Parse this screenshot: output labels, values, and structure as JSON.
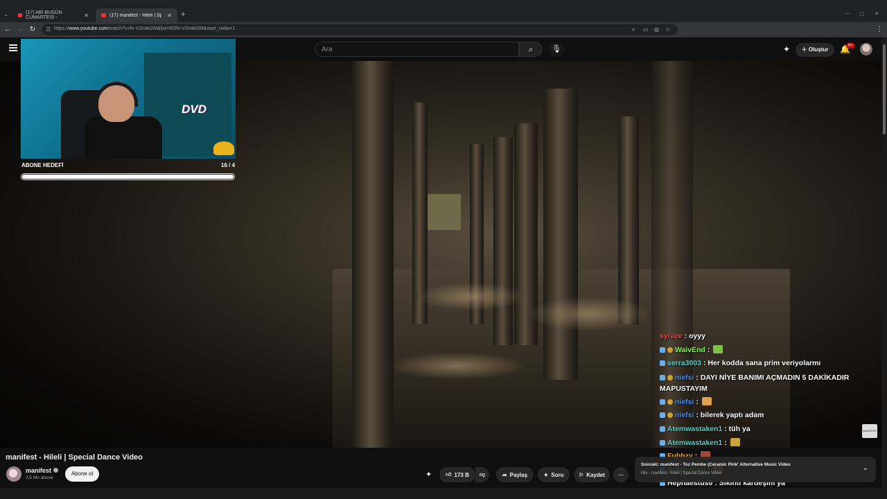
{
  "browser": {
    "tabs": [
      {
        "label": "(17) ABİ BUGÜN CUMARTESİ -",
        "active": false
      },
      {
        "label": "(17) manifest - Hileli | Special D",
        "active": true
      }
    ],
    "url_prefix": "https://",
    "url_host": "www.youtube.com",
    "url_path": "/watch?v=fn-V2mlei2M&list=RDfn-V2mlei2M&start_radio=1"
  },
  "header": {
    "search_placeholder": "Ara",
    "create_label": "Oluştur",
    "notifications_badge": "9+"
  },
  "overlay": {
    "goal_label": "ABONE HEDEFİ",
    "goal_count": "16 / 4",
    "goal_progress": 1.0,
    "dvd_text": "DVD"
  },
  "chat": [
    {
      "user": "syraze",
      "user_color": "#ff3b3b",
      "text": ": oyyy",
      "badges": 0
    },
    {
      "user": "WaivEnd",
      "user_color": "#7cfc4a",
      "text": ":",
      "badges": 2,
      "emote": true
    },
    {
      "user": "serra3003",
      "user_color": "#4fd2c8",
      "text": ": Her kodda sana prim veriyolarmı",
      "badges": 1
    },
    {
      "user": "niefsi",
      "user_color": "#3f8cff",
      "text": ": DAYI NİYE BANIMI AÇMADIN 5 DAKİKADIR MAPUSTAYIM",
      "badges": 2,
      "wrap": true
    },
    {
      "user": "niefsi",
      "user_color": "#3f8cff",
      "text": ":",
      "badges": 2,
      "emote": true
    },
    {
      "user": "niefsi",
      "user_color": "#3f8cff",
      "text": ": bilerek yaptı adam",
      "badges": 2
    },
    {
      "user": "Atemwastaken1",
      "user_color": "#4fd2c8",
      "text": ": tüh ya",
      "badges": 1
    },
    {
      "user": "Atemwastaken1",
      "user_color": "#4fd2c8",
      "text": ":",
      "badges": 1,
      "emote": true
    },
    {
      "user": "Fubbzy",
      "user_color": "#e8a628",
      "text": ":",
      "badges": 1,
      "emote": true
    },
    {
      "user": "WaivEnd",
      "user_color": "#7cfc4a",
      "text": ":",
      "badges": 2,
      "emote": true
    },
    {
      "user": "Hephaestus0",
      "user_color": "#ffffff",
      "text": ": Sıkıntı kardeşim ya",
      "badges": 1
    }
  ],
  "video": {
    "title": "manifest - Hileli | Special Dance Video",
    "channel": "manifest",
    "subscribers": "2,5 Mn abone",
    "subscribe_label": "Abone ol",
    "likes": "173 B",
    "share_label": "Paylaş",
    "ask_label": "Soru",
    "save_label": "Kaydet",
    "corner_logo": "MANIFEST"
  },
  "up_next": {
    "title": "Sonraki: manifest - Toz Pembe (Ceramic Pink' Alternative Music Video",
    "subtitle": "Mix - manifest - Hileli | Special Dance Video"
  }
}
